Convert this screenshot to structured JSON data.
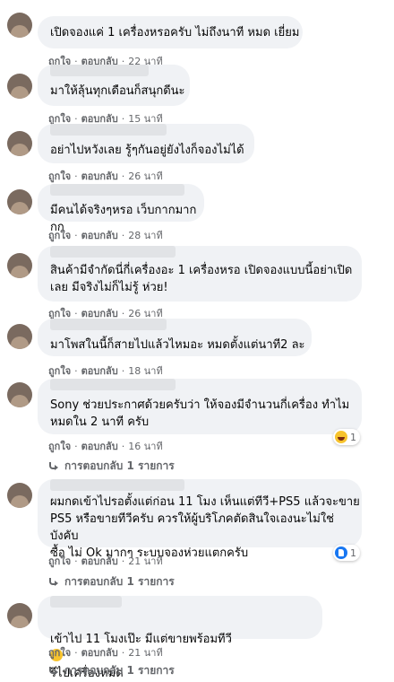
{
  "comments": [
    {
      "text": "เปิดจองแค่ 1 เครื่องหรอครับ ไม่ถึงนาที หมด เยี่ยม",
      "like": "ถูกใจ",
      "reply": "ตอบกลับ",
      "time": "22 นาที"
    },
    {
      "text": "มาให้ลุ้นทุกเดือนก็สนุกดีนะ",
      "like": "ถูกใจ",
      "reply": "ตอบกลับ",
      "time": "15 นาที"
    },
    {
      "text": "อย่าไปหวังเลย รู้ๆกันอยู่ยังไงก็จองไม่ได้",
      "like": "ถูกใจ",
      "reply": "ตอบกลับ",
      "time": "26 นาที"
    },
    {
      "text": "มีคนได้จริงๆหรอ เว็บกากมากกก",
      "like": "ถูกใจ",
      "reply": "ตอบกลับ",
      "time": "28 นาที"
    },
    {
      "text": "สินค้ามีจำกัดนี่กี่เครื่องอะ 1 เครื่องหรอ เปิดจองแบบนี้อย่าเปิด\nเลย มีจริงไม่ก็ไม่รู้ ห่วย!",
      "like": "ถูกใจ",
      "reply": "ตอบกลับ",
      "time": "26 นาที"
    },
    {
      "text": "มาโพสในนี้ก็สายไปแล้วไหมอะ หมดตั้งแต่นาที2 ละ",
      "like": "ถูกใจ",
      "reply": "ตอบกลับ",
      "time": "18 นาที"
    },
    {
      "text": "Sony ช่วยประกาศด้วยครับว่า ให้จองมีจำนวนกี่เครื่อง ทำไม\nหมดใน 2 นาที ครับ",
      "like": "ถูกใจ",
      "reply": "ตอบกลับ",
      "time": "16 นาที",
      "reaction": {
        "icon": "haha-icon",
        "count": "1"
      },
      "replies": "การตอบกลับ 1 รายการ"
    },
    {
      "text": "ผมกดเข้าไปรอตั้งแต่ก่อน 11 โมง เห็นแต่ทีวี+PS5 แล้วจะขาย\nPS5 หรือขายทีวีครับ ควรให้ผู้บริโภคตัดสินใจเองนะไม่ใช่บังคับ\nซื้อ ไม่ Ok มากๆ ระบบจองห่วยแตกครับ",
      "like": "ถูกใจ",
      "reply": "ตอบกลับ",
      "time": "21 นาที",
      "reaction": {
        "icon": "like-icon",
        "count": "1"
      },
      "replies": "การตอบกลับ 1 รายการ"
    },
    {
      "text_a": "เข้าไป 11 โมงเป๊ะ มีแต่ขายพร้อมทีวี",
      "text_b": "รีไปเครื่องหมด",
      "like": "ถูกใจ",
      "reply": "ตอบกลับ",
      "time": "21 นาที",
      "replies": "การตอบกลับ 1 รายการ"
    }
  ],
  "colors": {
    "bubble": "#f0f2f5",
    "meta": "#65676b",
    "text": "#050505"
  }
}
